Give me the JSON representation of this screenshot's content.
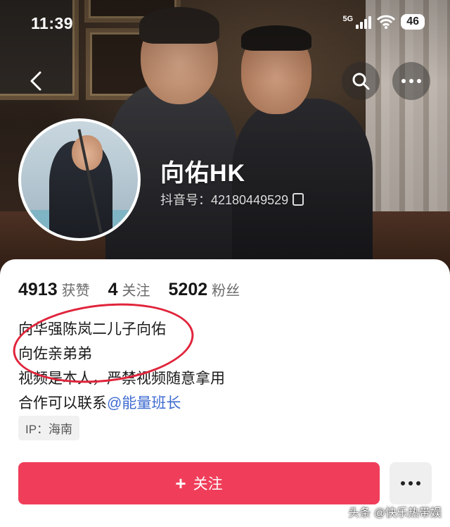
{
  "status_bar": {
    "time": "11:39",
    "network": "5G",
    "battery": "46"
  },
  "profile": {
    "name": "向佑HK",
    "douyin_id": "抖音号：42180449529"
  },
  "stats": [
    {
      "value": "4913",
      "label": "获赞"
    },
    {
      "value": "4",
      "label": "关注"
    },
    {
      "value": "5202",
      "label": "粉丝"
    }
  ],
  "bio": {
    "line1": "向华强陈岚二儿子向佑",
    "line2": "向佐亲弟弟",
    "line3": "视频是本人，严禁视频随意拿用",
    "line4_prefix": "合作可以联系",
    "line4_mention": "@能量班长"
  },
  "ip_label": "IP：海南",
  "actions": {
    "follow_label": "关注"
  },
  "watermark": "头条 @快乐热带娱",
  "colors": {
    "follow": "#f03e5a",
    "mention": "#3d6ad0",
    "annotation_circle": "#e0243b"
  },
  "icons": [
    "back-icon",
    "search-icon",
    "more-icon",
    "copy-icon",
    "plus-icon",
    "signal-icon",
    "wifi-icon"
  ]
}
